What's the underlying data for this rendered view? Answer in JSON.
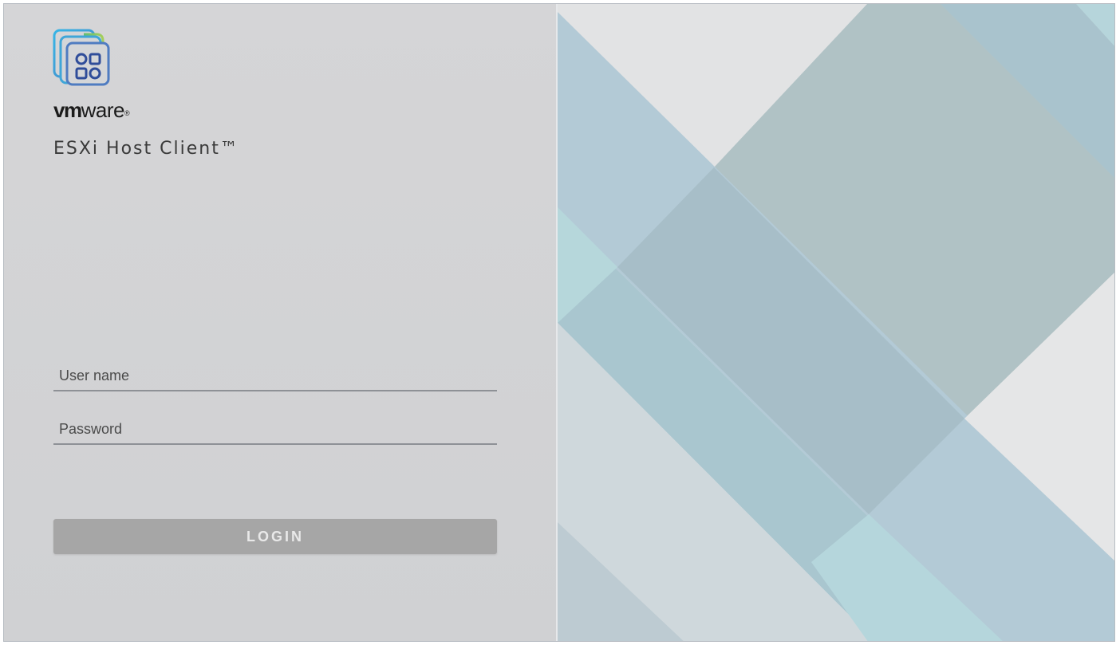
{
  "brand": {
    "vm": "vm",
    "ware": "ware",
    "registered": "®"
  },
  "product_name": "ESXi Host Client™",
  "login_form": {
    "username_placeholder": "User name",
    "username_value": "",
    "password_placeholder": "Password",
    "password_value": "",
    "login_label": "LOGIN"
  },
  "icons": {
    "logo": "vmware-host-client-logo-icon"
  },
  "colors": {
    "left_panel_bg": "#d2d3d5",
    "login_button_bg": "#a6a6a6",
    "login_button_text": "#e9e9e9",
    "field_underline": "#8e9196",
    "pattern_light": "#e4e4e5",
    "pattern_blue": "#b3cad6",
    "pattern_teal": "#b0c2c5",
    "pattern_cyan": "#b5d6dc"
  }
}
